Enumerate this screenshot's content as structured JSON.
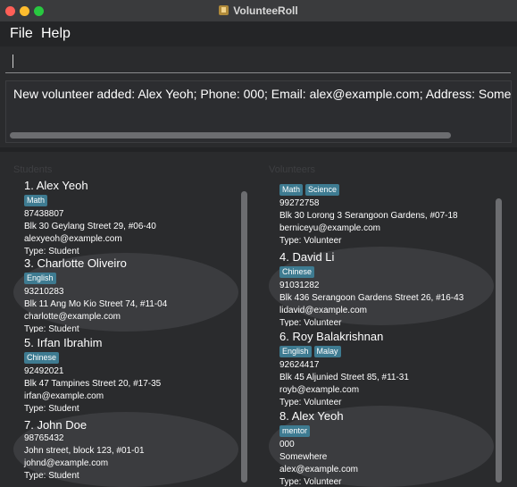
{
  "window": {
    "title": "VolunteeRoll"
  },
  "menu": {
    "file": "File",
    "help": "Help"
  },
  "command": {
    "value": ""
  },
  "result": {
    "text": "New volunteer added: Alex Yeoh; Phone: 000; Email: alex@example.com; Address: Somewhere; Ta"
  },
  "students": {
    "title": "Students",
    "cards": [
      {
        "name": "1. Alex Yeoh",
        "tags": [
          "Math"
        ],
        "phone": "87438807",
        "address": "Blk 30 Geylang Street 29, #06-40",
        "email": "alexyeoh@example.com",
        "type": "Type: Student"
      },
      {
        "name": "3. Charlotte Oliveiro",
        "tags": [
          "English"
        ],
        "phone": "93210283",
        "address": "Blk 11 Ang Mo Kio Street 74, #11-04",
        "email": "charlotte@example.com",
        "type": "Type: Student"
      },
      {
        "name": "5. Irfan Ibrahim",
        "tags": [
          "Chinese"
        ],
        "phone": "92492021",
        "address": "Blk 47 Tampines Street 20, #17-35",
        "email": "irfan@example.com",
        "type": "Type: Student"
      },
      {
        "name": "7. John Doe",
        "tags": [],
        "phone": "98765432",
        "address": "John street, block 123, #01-01",
        "email": "johnd@example.com",
        "type": "Type: Student"
      }
    ]
  },
  "volunteers": {
    "title": "Volunteers",
    "cards": [
      {
        "name": "",
        "tags": [
          "Math",
          "Science"
        ],
        "phone": "99272758",
        "address": "Blk 30 Lorong 3 Serangoon Gardens, #07-18",
        "email": "berniceyu@example.com",
        "type": "Type: Volunteer"
      },
      {
        "name": "4. David Li",
        "tags": [
          "Chinese"
        ],
        "phone": "91031282",
        "address": "Blk 436 Serangoon Gardens Street 26, #16-43",
        "email": "lidavid@example.com",
        "type": "Type: Volunteer"
      },
      {
        "name": "6. Roy Balakrishnan",
        "tags": [
          "English",
          "Malay"
        ],
        "phone": "92624417",
        "address": "Blk 45 Aljunied Street 85, #11-31",
        "email": "royb@example.com",
        "type": "Type: Volunteer"
      },
      {
        "name": "8. Alex Yeoh",
        "tags": [
          "mentor"
        ],
        "phone": "000",
        "address": "Somewhere",
        "email": "alex@example.com",
        "type": "Type: Volunteer"
      }
    ]
  }
}
